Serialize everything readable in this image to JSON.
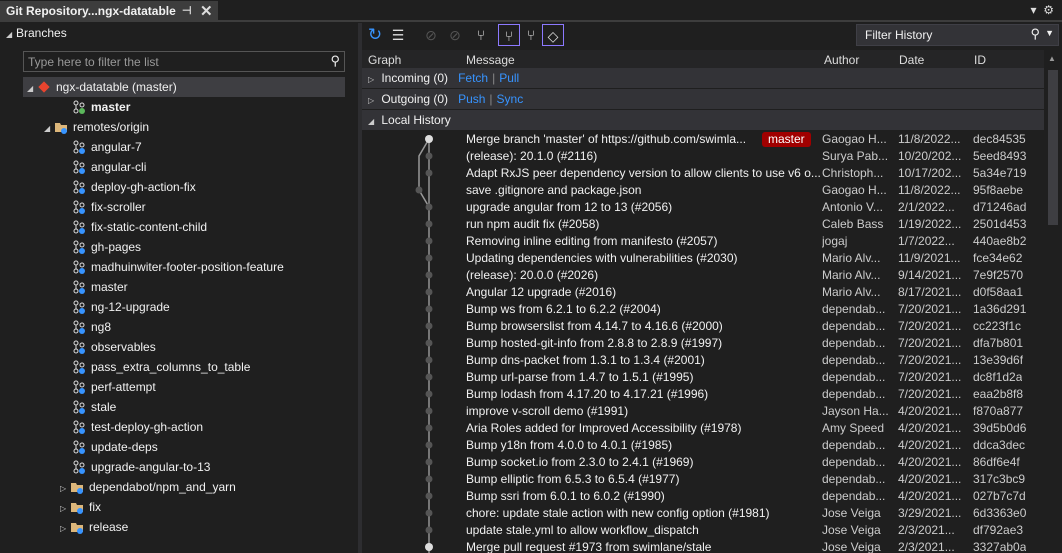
{
  "tab": {
    "title": "Git Repository...ngx-datatable",
    "pin_icon": "pin-icon",
    "close_icon": "close-icon"
  },
  "branches": {
    "header": "Branches",
    "filter_placeholder": "Type here to filter the list",
    "repo": "ngx-datatable (master)",
    "local_master": "master",
    "remotes": "remotes/origin",
    "remote_branches": [
      "angular-7",
      "angular-cli",
      "deploy-gh-action-fix",
      "fix-scroller",
      "fix-static-content-child",
      "gh-pages",
      "madhuinwiter-footer-position-feature",
      "master",
      "ng-12-upgrade",
      "ng8",
      "observables",
      "pass_extra_columns_to_table",
      "perf-attempt",
      "stale",
      "test-deploy-gh-action",
      "update-deps",
      "upgrade-angular-to-13"
    ],
    "folders": [
      "dependabot/npm_and_yarn",
      "fix",
      "release"
    ]
  },
  "history": {
    "filter_placeholder": "Filter History",
    "columns": {
      "graph": "Graph",
      "message": "Message",
      "author": "Author",
      "date": "Date",
      "id": "ID"
    },
    "incoming": {
      "label": "Incoming (0)",
      "fetch": "Fetch",
      "pull": "Pull"
    },
    "outgoing": {
      "label": "Outgoing (0)",
      "push": "Push",
      "sync": "Sync"
    },
    "local": "Local History",
    "tag_color": "#a00000",
    "commits": [
      {
        "message": "Merge branch 'master' of https://github.com/swimla...",
        "tag": "master",
        "author": "Gaogao H...",
        "date": "11/8/2022...",
        "id": "dec84535"
      },
      {
        "message": "(release): 20.1.0 (#2116)",
        "author": "Surya Pab...",
        "date": "10/20/202...",
        "id": "5eed8493"
      },
      {
        "message": "Adapt RxJS peer dependency version to allow clients to use v6 o...",
        "author": "Christoph...",
        "date": "10/17/202...",
        "id": "5a34e719"
      },
      {
        "message": "save .gitignore and package.json",
        "author": "Gaogao H...",
        "date": "11/8/2022...",
        "id": "95f8aebe"
      },
      {
        "message": "upgrade angular from 12 to 13 (#2056)",
        "author": "Antonio V...",
        "date": "2/1/2022...",
        "id": "d71246ad"
      },
      {
        "message": "run npm audit fix (#2058)",
        "author": "Caleb Bass",
        "date": "1/19/2022...",
        "id": "2501d453"
      },
      {
        "message": "Removing inline editing from manifesto (#2057)",
        "author": "jogaj",
        "date": "1/7/2022...",
        "id": "440ae8b2"
      },
      {
        "message": "Updating dependencies with vulnerabilities (#2030)",
        "author": "Mario Alv...",
        "date": "11/9/2021...",
        "id": "fce34e62"
      },
      {
        "message": "(release): 20.0.0 (#2026)",
        "author": "Mario Alv...",
        "date": "9/14/2021...",
        "id": "7e9f2570"
      },
      {
        "message": "Angular 12 upgrade (#2016)",
        "author": "Mario Alv...",
        "date": "8/17/2021...",
        "id": "d0f58aa1"
      },
      {
        "message": "Bump ws from 6.2.1 to 6.2.2 (#2004)",
        "author": "dependab...",
        "date": "7/20/2021...",
        "id": "1a36d291"
      },
      {
        "message": "Bump browserslist from 4.14.7 to 4.16.6 (#2000)",
        "author": "dependab...",
        "date": "7/20/2021...",
        "id": "cc223f1c"
      },
      {
        "message": "Bump hosted-git-info from 2.8.8 to 2.8.9 (#1997)",
        "author": "dependab...",
        "date": "7/20/2021...",
        "id": "dfa7b801"
      },
      {
        "message": "Bump dns-packet from 1.3.1 to 1.3.4 (#2001)",
        "author": "dependab...",
        "date": "7/20/2021...",
        "id": "13e39d6f"
      },
      {
        "message": "Bump url-parse from 1.4.7 to 1.5.1 (#1995)",
        "author": "dependab...",
        "date": "7/20/2021...",
        "id": "dc8f1d2a"
      },
      {
        "message": "Bump lodash from 4.17.20 to 4.17.21 (#1996)",
        "author": "dependab...",
        "date": "7/20/2021...",
        "id": "eaa2b8f8"
      },
      {
        "message": "improve v-scroll demo (#1991)",
        "author": "Jayson Ha...",
        "date": "4/20/2021...",
        "id": "f870a877"
      },
      {
        "message": "Aria Roles added for Improved Accessibility (#1978)",
        "author": "Amy Speed",
        "date": "4/20/2021...",
        "id": "39d5b0d6"
      },
      {
        "message": "Bump y18n from 4.0.0 to 4.0.1 (#1985)",
        "author": "dependab...",
        "date": "4/20/2021...",
        "id": "ddca3dec"
      },
      {
        "message": "Bump socket.io from 2.3.0 to 2.4.1 (#1969)",
        "author": "dependab...",
        "date": "4/20/2021...",
        "id": "86df6e4f"
      },
      {
        "message": "Bump elliptic from 6.5.3 to 6.5.4 (#1977)",
        "author": "dependab...",
        "date": "4/20/2021...",
        "id": "317c3bc9"
      },
      {
        "message": "Bump ssri from 6.0.1 to 6.0.2 (#1990)",
        "author": "dependab...",
        "date": "4/20/2021...",
        "id": "027b7c7d"
      },
      {
        "message": "chore: update stale action with new config option (#1981)",
        "author": "Jose Veiga",
        "date": "3/29/2021...",
        "id": "6d3363e0"
      },
      {
        "message": "update stale.yml to allow workflow_dispatch",
        "author": "Jose Veiga",
        "date": "2/3/2021...",
        "id": "df792ae3"
      },
      {
        "message": "Merge pull request #1973 from swimlane/stale",
        "author": "Jose Veiga",
        "date": "2/3/2021...",
        "id": "3327ab0a"
      }
    ]
  }
}
